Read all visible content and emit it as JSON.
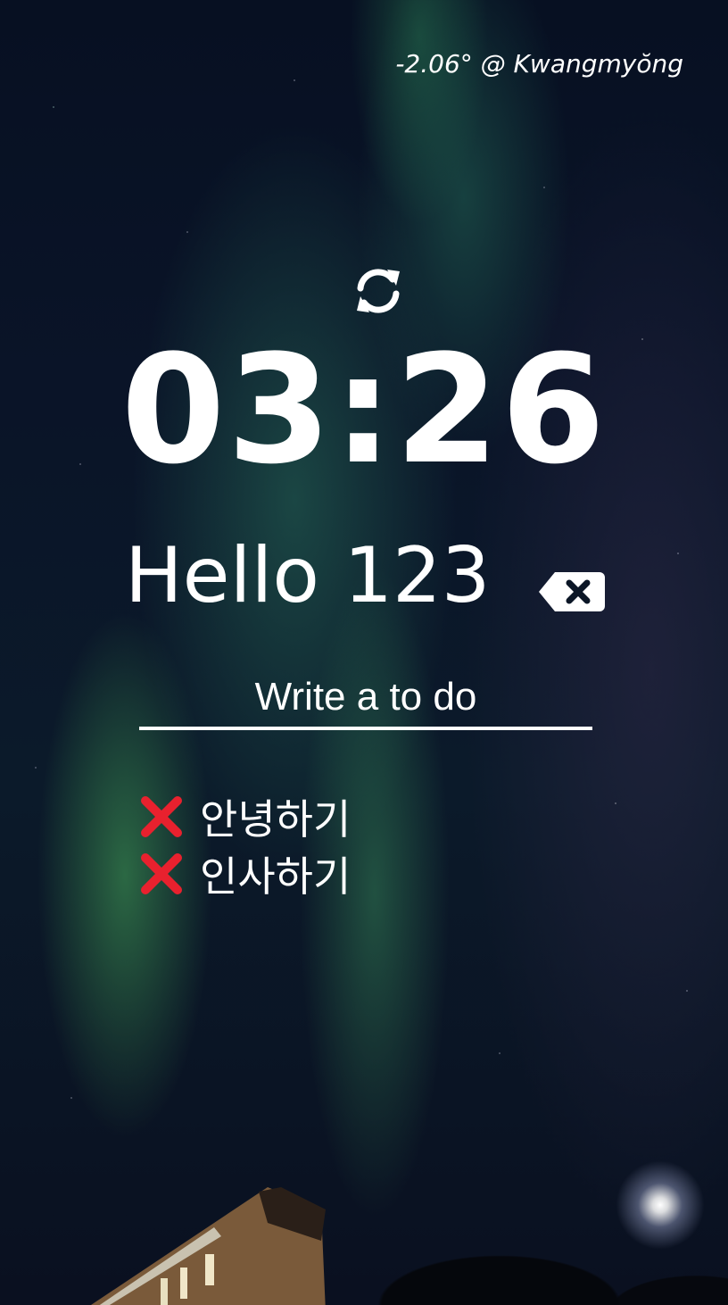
{
  "weather": {
    "text": "-2.06° @ Kwangmyŏng"
  },
  "refresh": {
    "icon": "refresh-icon"
  },
  "clock": {
    "time": "03:26"
  },
  "greeting": {
    "text": "Hello 123",
    "logout_icon": "backspace-delete-icon"
  },
  "todo_input": {
    "placeholder": "Write a to do",
    "value": ""
  },
  "todos": [
    {
      "label": "안녕하기",
      "delete_icon": "red-x-icon"
    },
    {
      "label": "인사하기",
      "delete_icon": "red-x-icon"
    }
  ],
  "colors": {
    "text": "#ffffff",
    "delete_x": "#e8212e",
    "background": "#0a1428"
  }
}
